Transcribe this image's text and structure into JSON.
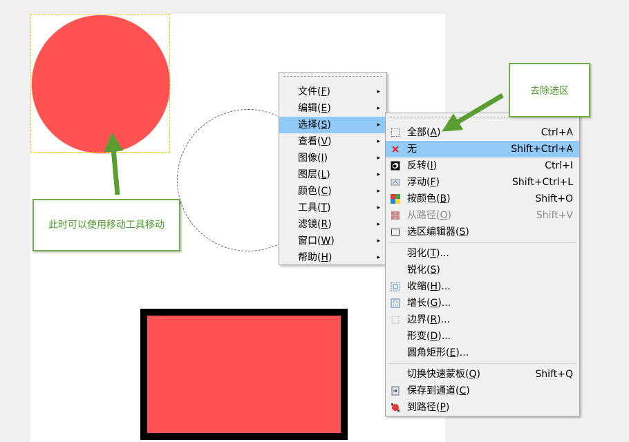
{
  "menu": {
    "items": [
      {
        "label": "文件(F)",
        "underline": "F"
      },
      {
        "label": "编辑(E)",
        "underline": "E"
      },
      {
        "label": "选择(S)",
        "underline": "S",
        "active": true
      },
      {
        "label": "查看(V)",
        "underline": "V"
      },
      {
        "label": "图像(I)",
        "underline": "I"
      },
      {
        "label": "图层(L)",
        "underline": "L"
      },
      {
        "label": "颜色(C)",
        "underline": "C"
      },
      {
        "label": "工具(T)",
        "underline": "T"
      },
      {
        "label": "滤镜(R)",
        "underline": "R"
      },
      {
        "label": "窗口(W)",
        "underline": "W"
      },
      {
        "label": "帮助(H)",
        "underline": "H"
      }
    ],
    "arrow": "▸"
  },
  "submenu": {
    "groups": [
      [
        {
          "label": "全部(A)",
          "shortcut": "Ctrl+A",
          "icon": "select-all-icon"
        },
        {
          "label": "无",
          "shortcut": "Shift+Ctrl+A",
          "icon": "select-none-icon",
          "active": true
        },
        {
          "label": "反转(I)",
          "shortcut": "Ctrl+I",
          "icon": "invert-icon"
        },
        {
          "label": "浮动(F)",
          "shortcut": "Shift+Ctrl+L",
          "icon": "float-icon"
        },
        {
          "label": "按颜色(B)",
          "shortcut": "Shift+O",
          "icon": "by-color-icon"
        },
        {
          "label": "从路径(O)",
          "shortcut": "Shift+V",
          "icon": "from-path-icon",
          "disabled": true
        },
        {
          "label": "选区编辑器(S)",
          "shortcut": "",
          "icon": "selection-editor-icon"
        }
      ],
      [
        {
          "label": "羽化(T)...",
          "shortcut": "",
          "icon": ""
        },
        {
          "label": "锐化(S)",
          "shortcut": "",
          "icon": ""
        },
        {
          "label": "收缩(H)...",
          "shortcut": "",
          "icon": "shrink-icon"
        },
        {
          "label": "增长(G)...",
          "shortcut": "",
          "icon": "grow-icon"
        },
        {
          "label": "边界(R)...",
          "shortcut": "",
          "icon": "border-icon"
        },
        {
          "label": "形变(D)...",
          "shortcut": "",
          "icon": ""
        },
        {
          "label": "圆角矩形(E)...",
          "shortcut": "",
          "icon": ""
        }
      ],
      [
        {
          "label": "切换快速蒙板(Q)",
          "shortcut": "Shift+Q",
          "icon": ""
        },
        {
          "label": "保存到通道(C)",
          "shortcut": "",
          "icon": "save-channel-icon"
        },
        {
          "label": "到路径(P)",
          "shortcut": "",
          "icon": "to-path-icon"
        }
      ]
    ]
  },
  "callouts": {
    "move_hint": "此时可以使用移动工具移动",
    "deselect_hint": "去除选区"
  },
  "colors": {
    "shape_fill": "#ff5252",
    "highlight": "#91c9f7",
    "callout_green": "#70ad47"
  }
}
